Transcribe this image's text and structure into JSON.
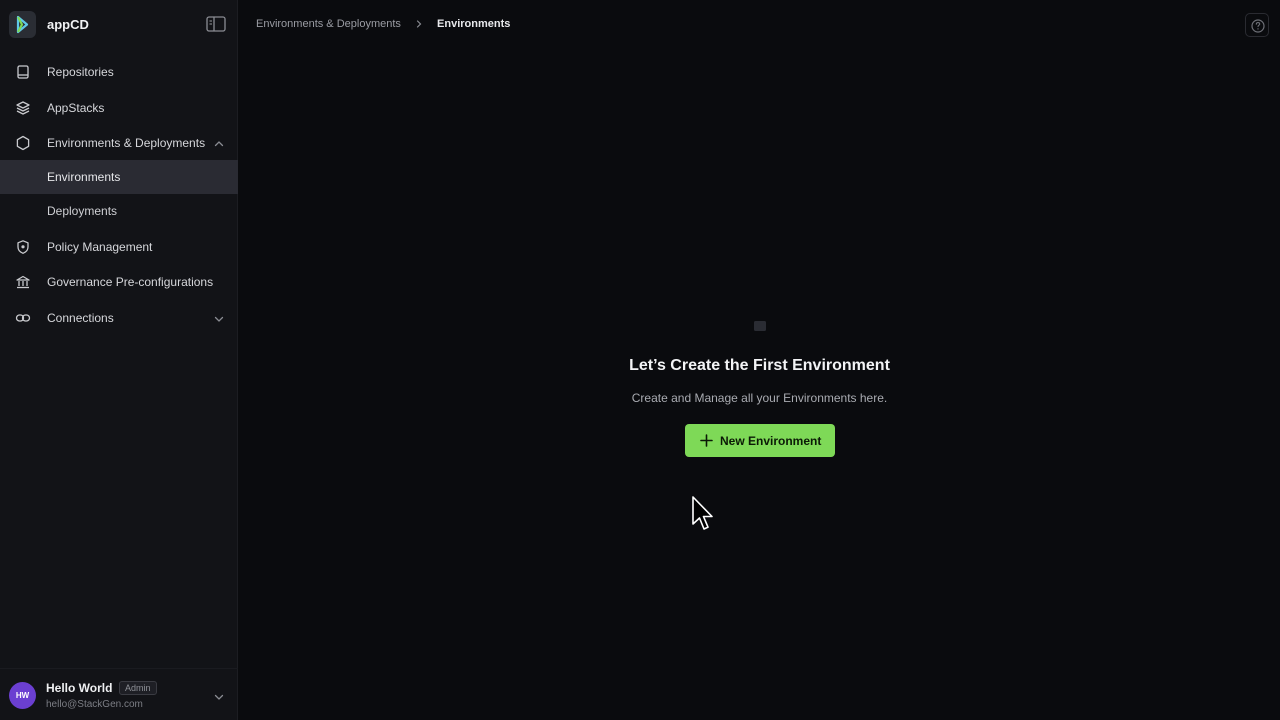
{
  "app": {
    "name": "appCD"
  },
  "sidebar": {
    "items": [
      {
        "label": "Repositories",
        "icon": "book-icon"
      },
      {
        "label": "AppStacks",
        "icon": "layers-icon"
      },
      {
        "label": "Environments & Deployments",
        "icon": "hexagon-icon",
        "expanded": true,
        "children": [
          {
            "label": "Environments",
            "active": true
          },
          {
            "label": "Deployments"
          }
        ]
      },
      {
        "label": "Policy Management",
        "icon": "shield-icon"
      },
      {
        "label": "Governance Pre-configurations",
        "icon": "bank-icon"
      },
      {
        "label": "Connections",
        "icon": "link-icon",
        "expanded": false
      }
    ]
  },
  "user": {
    "initials": "HW",
    "name": "Hello World",
    "role": "Admin",
    "email": "hello@StackGen.com"
  },
  "breadcrumb": [
    "Environments & Deployments",
    "Environments"
  ],
  "empty_state": {
    "title": "Let’s Create the First Environment",
    "description": "Create and Manage all your Environments here.",
    "button_label": "New Environment"
  },
  "colors": {
    "accent": "#7ed957",
    "sidebar_bg": "#121317",
    "main_bg": "#0a0b0e",
    "active_item_bg": "#2a2b33",
    "avatar_bg": "#6b3fd1"
  }
}
